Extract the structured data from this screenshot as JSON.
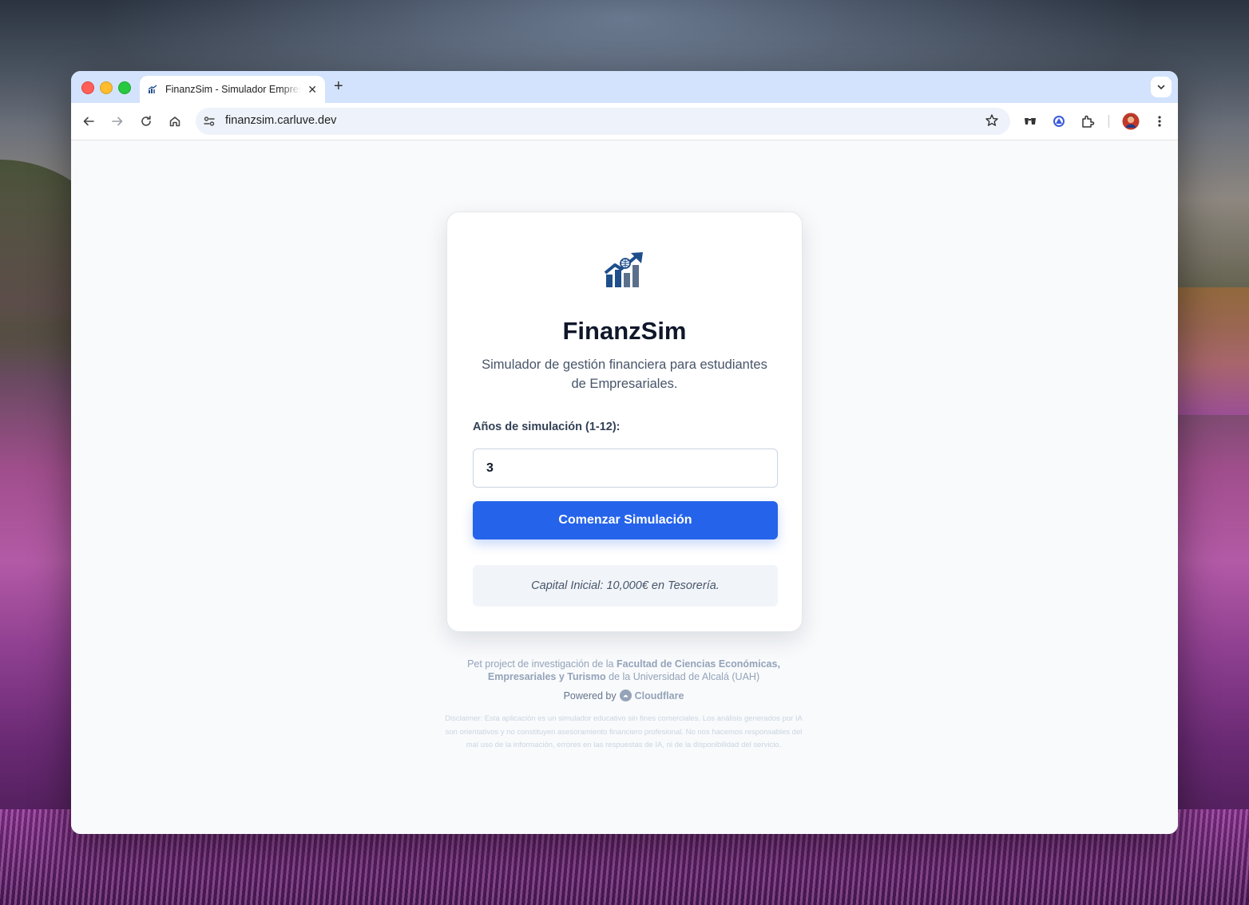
{
  "browser": {
    "tab": {
      "title": "FinanzSim - Simulador Empresarial"
    },
    "address_bar": {
      "url": "finanzsim.carluve.dev"
    }
  },
  "app": {
    "title": "FinanzSim",
    "subtitle": "Simulador de gestión financiera para estudiantes de Empresariales.",
    "years_label": "Años de simulación (1-12):",
    "years_value": "3",
    "start_button": "Comenzar Simulación",
    "capital_note": "Capital Inicial: 10,000€ en Tesorería."
  },
  "footer": {
    "credit_prefix": "Pet project de investigación de la",
    "credit_faculty": "Facultad de Ciencias Económicas, Empresariales y Turismo",
    "credit_suffix": "de la Universidad de Alcalá (UAH)",
    "powered_by": "Powered by",
    "provider": "Cloudflare",
    "disclaimer": "Disclaimer: Esta aplicación es un simulador educativo sin fines comerciales. Los análisis generados por IA son orientativos y no constituyen asesoramiento financiero profesional. No nos hacemos responsables del mal uso de la información, errores en las respuestas de IA, ni de la disponibilidad del servicio."
  },
  "colors": {
    "primary": "#2563eb",
    "title": "#0f172a",
    "page_bg": "#f8fafc",
    "tabstrip": "#d3e3fd"
  },
  "icons": [
    "finance-chart-logo-icon",
    "back-arrow-icon",
    "forward-arrow-icon",
    "reload-icon",
    "home-icon",
    "site-settings-icon",
    "bookmark-star-icon",
    "extension-icon",
    "profile-avatar-icon",
    "more-menu-icon",
    "cloudflare-icon"
  ]
}
